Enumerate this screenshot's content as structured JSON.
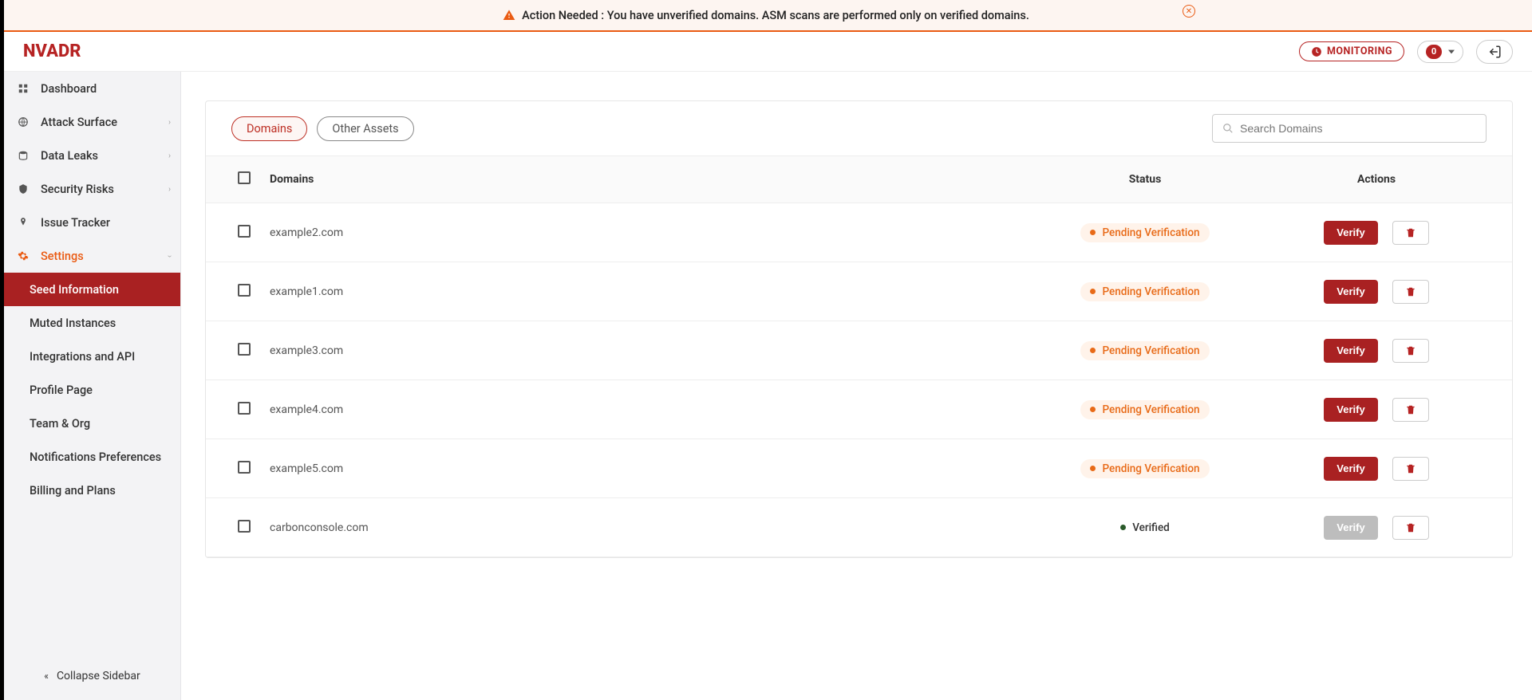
{
  "banner": {
    "text": "Action Needed : You have unverified domains. ASM scans are performed only on verified domains."
  },
  "brand": "NVADR",
  "header": {
    "monitoring_label": "MONITORING",
    "notification_count": "0"
  },
  "sidebar": {
    "items": [
      {
        "label": "Dashboard"
      },
      {
        "label": "Attack Surface"
      },
      {
        "label": "Data Leaks"
      },
      {
        "label": "Security Risks"
      },
      {
        "label": "Issue Tracker"
      },
      {
        "label": "Settings"
      }
    ],
    "settings_children": [
      {
        "label": "Seed Information"
      },
      {
        "label": "Muted Instances"
      },
      {
        "label": "Integrations and API"
      },
      {
        "label": "Profile Page"
      },
      {
        "label": "Team & Org"
      },
      {
        "label": "Notifications Preferences"
      },
      {
        "label": "Billing and Plans"
      }
    ],
    "collapse_label": "Collapse Sidebar"
  },
  "tabs": {
    "domains": "Domains",
    "other": "Other Assets"
  },
  "search": {
    "placeholder": "Search Domains"
  },
  "table": {
    "headers": {
      "domain": "Domains",
      "status": "Status",
      "actions": "Actions"
    },
    "verify_label": "Verify",
    "status_pending": "Pending Verification",
    "status_verified": "Verified",
    "rows": [
      {
        "domain": "example2.com",
        "status": "pending"
      },
      {
        "domain": "example1.com",
        "status": "pending"
      },
      {
        "domain": "example3.com",
        "status": "pending"
      },
      {
        "domain": "example4.com",
        "status": "pending"
      },
      {
        "domain": "example5.com",
        "status": "pending"
      },
      {
        "domain": "carbonconsole.com",
        "status": "verified"
      }
    ]
  }
}
